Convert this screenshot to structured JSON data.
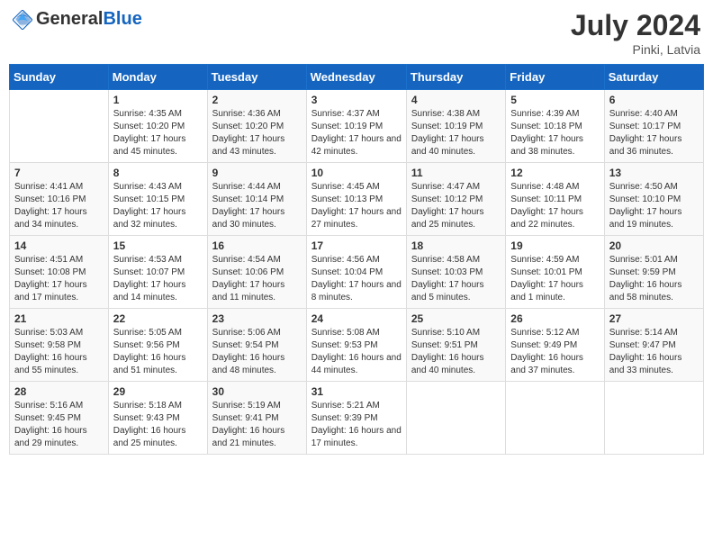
{
  "header": {
    "logo_general": "General",
    "logo_blue": "Blue",
    "month_year": "July 2024",
    "location": "Pinki, Latvia"
  },
  "weekdays": [
    "Sunday",
    "Monday",
    "Tuesday",
    "Wednesday",
    "Thursday",
    "Friday",
    "Saturday"
  ],
  "weeks": [
    [
      {
        "day": "",
        "sunrise": "",
        "sunset": "",
        "daylight": ""
      },
      {
        "day": "1",
        "sunrise": "Sunrise: 4:35 AM",
        "sunset": "Sunset: 10:20 PM",
        "daylight": "Daylight: 17 hours and 45 minutes."
      },
      {
        "day": "2",
        "sunrise": "Sunrise: 4:36 AM",
        "sunset": "Sunset: 10:20 PM",
        "daylight": "Daylight: 17 hours and 43 minutes."
      },
      {
        "day": "3",
        "sunrise": "Sunrise: 4:37 AM",
        "sunset": "Sunset: 10:19 PM",
        "daylight": "Daylight: 17 hours and 42 minutes."
      },
      {
        "day": "4",
        "sunrise": "Sunrise: 4:38 AM",
        "sunset": "Sunset: 10:19 PM",
        "daylight": "Daylight: 17 hours and 40 minutes."
      },
      {
        "day": "5",
        "sunrise": "Sunrise: 4:39 AM",
        "sunset": "Sunset: 10:18 PM",
        "daylight": "Daylight: 17 hours and 38 minutes."
      },
      {
        "day": "6",
        "sunrise": "Sunrise: 4:40 AM",
        "sunset": "Sunset: 10:17 PM",
        "daylight": "Daylight: 17 hours and 36 minutes."
      }
    ],
    [
      {
        "day": "7",
        "sunrise": "Sunrise: 4:41 AM",
        "sunset": "Sunset: 10:16 PM",
        "daylight": "Daylight: 17 hours and 34 minutes."
      },
      {
        "day": "8",
        "sunrise": "Sunrise: 4:43 AM",
        "sunset": "Sunset: 10:15 PM",
        "daylight": "Daylight: 17 hours and 32 minutes."
      },
      {
        "day": "9",
        "sunrise": "Sunrise: 4:44 AM",
        "sunset": "Sunset: 10:14 PM",
        "daylight": "Daylight: 17 hours and 30 minutes."
      },
      {
        "day": "10",
        "sunrise": "Sunrise: 4:45 AM",
        "sunset": "Sunset: 10:13 PM",
        "daylight": "Daylight: 17 hours and 27 minutes."
      },
      {
        "day": "11",
        "sunrise": "Sunrise: 4:47 AM",
        "sunset": "Sunset: 10:12 PM",
        "daylight": "Daylight: 17 hours and 25 minutes."
      },
      {
        "day": "12",
        "sunrise": "Sunrise: 4:48 AM",
        "sunset": "Sunset: 10:11 PM",
        "daylight": "Daylight: 17 hours and 22 minutes."
      },
      {
        "day": "13",
        "sunrise": "Sunrise: 4:50 AM",
        "sunset": "Sunset: 10:10 PM",
        "daylight": "Daylight: 17 hours and 19 minutes."
      }
    ],
    [
      {
        "day": "14",
        "sunrise": "Sunrise: 4:51 AM",
        "sunset": "Sunset: 10:08 PM",
        "daylight": "Daylight: 17 hours and 17 minutes."
      },
      {
        "day": "15",
        "sunrise": "Sunrise: 4:53 AM",
        "sunset": "Sunset: 10:07 PM",
        "daylight": "Daylight: 17 hours and 14 minutes."
      },
      {
        "day": "16",
        "sunrise": "Sunrise: 4:54 AM",
        "sunset": "Sunset: 10:06 PM",
        "daylight": "Daylight: 17 hours and 11 minutes."
      },
      {
        "day": "17",
        "sunrise": "Sunrise: 4:56 AM",
        "sunset": "Sunset: 10:04 PM",
        "daylight": "Daylight: 17 hours and 8 minutes."
      },
      {
        "day": "18",
        "sunrise": "Sunrise: 4:58 AM",
        "sunset": "Sunset: 10:03 PM",
        "daylight": "Daylight: 17 hours and 5 minutes."
      },
      {
        "day": "19",
        "sunrise": "Sunrise: 4:59 AM",
        "sunset": "Sunset: 10:01 PM",
        "daylight": "Daylight: 17 hours and 1 minute."
      },
      {
        "day": "20",
        "sunrise": "Sunrise: 5:01 AM",
        "sunset": "Sunset: 9:59 PM",
        "daylight": "Daylight: 16 hours and 58 minutes."
      }
    ],
    [
      {
        "day": "21",
        "sunrise": "Sunrise: 5:03 AM",
        "sunset": "Sunset: 9:58 PM",
        "daylight": "Daylight: 16 hours and 55 minutes."
      },
      {
        "day": "22",
        "sunrise": "Sunrise: 5:05 AM",
        "sunset": "Sunset: 9:56 PM",
        "daylight": "Daylight: 16 hours and 51 minutes."
      },
      {
        "day": "23",
        "sunrise": "Sunrise: 5:06 AM",
        "sunset": "Sunset: 9:54 PM",
        "daylight": "Daylight: 16 hours and 48 minutes."
      },
      {
        "day": "24",
        "sunrise": "Sunrise: 5:08 AM",
        "sunset": "Sunset: 9:53 PM",
        "daylight": "Daylight: 16 hours and 44 minutes."
      },
      {
        "day": "25",
        "sunrise": "Sunrise: 5:10 AM",
        "sunset": "Sunset: 9:51 PM",
        "daylight": "Daylight: 16 hours and 40 minutes."
      },
      {
        "day": "26",
        "sunrise": "Sunrise: 5:12 AM",
        "sunset": "Sunset: 9:49 PM",
        "daylight": "Daylight: 16 hours and 37 minutes."
      },
      {
        "day": "27",
        "sunrise": "Sunrise: 5:14 AM",
        "sunset": "Sunset: 9:47 PM",
        "daylight": "Daylight: 16 hours and 33 minutes."
      }
    ],
    [
      {
        "day": "28",
        "sunrise": "Sunrise: 5:16 AM",
        "sunset": "Sunset: 9:45 PM",
        "daylight": "Daylight: 16 hours and 29 minutes."
      },
      {
        "day": "29",
        "sunrise": "Sunrise: 5:18 AM",
        "sunset": "Sunset: 9:43 PM",
        "daylight": "Daylight: 16 hours and 25 minutes."
      },
      {
        "day": "30",
        "sunrise": "Sunrise: 5:19 AM",
        "sunset": "Sunset: 9:41 PM",
        "daylight": "Daylight: 16 hours and 21 minutes."
      },
      {
        "day": "31",
        "sunrise": "Sunrise: 5:21 AM",
        "sunset": "Sunset: 9:39 PM",
        "daylight": "Daylight: 16 hours and 17 minutes."
      },
      {
        "day": "",
        "sunrise": "",
        "sunset": "",
        "daylight": ""
      },
      {
        "day": "",
        "sunrise": "",
        "sunset": "",
        "daylight": ""
      },
      {
        "day": "",
        "sunrise": "",
        "sunset": "",
        "daylight": ""
      }
    ]
  ]
}
